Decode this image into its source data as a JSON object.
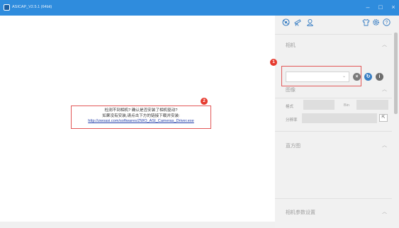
{
  "window": {
    "title": "ASICAP_V2.5.1 (64bit)",
    "minimize": "–",
    "maximize": "□",
    "close": "×"
  },
  "preview": {
    "notice_line1": "检测不到相机? 确认是否安装了相机驱动?",
    "notice_line2": "如果没有安装,请点击下方的链接下载并安装:",
    "driver_link": "http://zwoasi.com/softwares/ZWO_ASI_Cameras_Driver.exe",
    "badge": "2"
  },
  "toolbar": {
    "icons": [
      "ball-icon",
      "telescope-icon",
      "user-profile-icon",
      "shirt-icon",
      "settings-gear-icon",
      "help-icon"
    ]
  },
  "panel": {
    "camera": {
      "title": "相机",
      "selected": "",
      "badge": "1"
    },
    "image": {
      "title": "图像",
      "format_label": "格式",
      "bin_label": "Bin",
      "resolution_label": "分辨率"
    },
    "histogram": {
      "title": "直方图"
    },
    "camera_params": {
      "title": "相机参数设置"
    }
  },
  "colors": {
    "titlebar": "#2f8cdd",
    "accent_blue": "#3a7fc4",
    "marker_red": "#e63a2e"
  }
}
